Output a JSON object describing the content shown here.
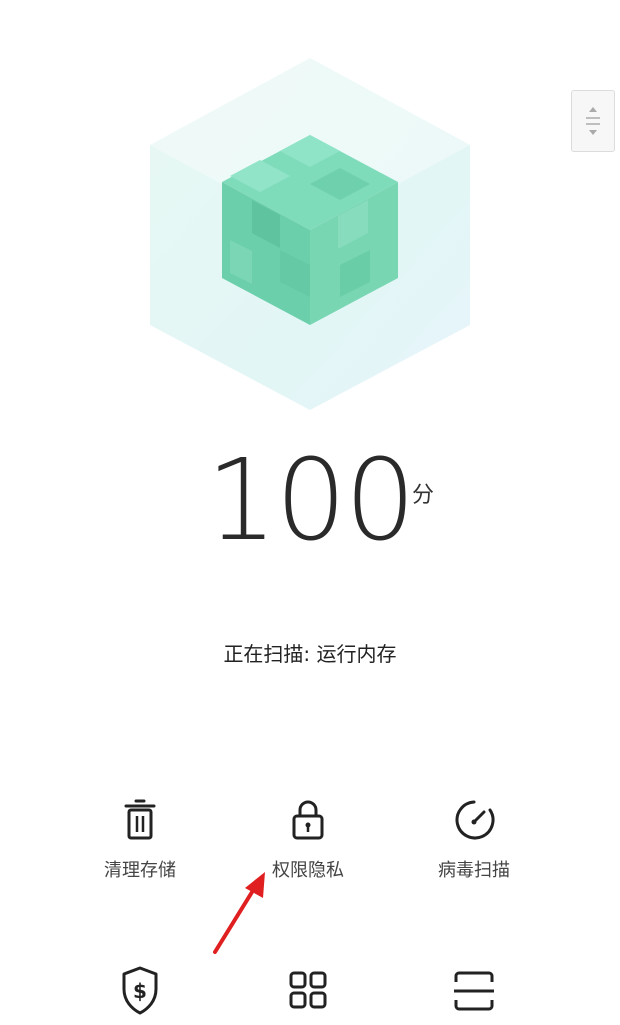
{
  "score": {
    "value": "100",
    "unit": "分"
  },
  "status": {
    "text": "正在扫描: 运行内存"
  },
  "tools": [
    {
      "label": "清理存储",
      "icon": "trash-icon"
    },
    {
      "label": "权限隐私",
      "icon": "lock-icon"
    },
    {
      "label": "病毒扫描",
      "icon": "gauge-icon"
    }
  ],
  "bottom_icons": [
    "shield-dollar-icon",
    "grid-icon",
    "scan-icon"
  ],
  "colors": {
    "cube": "#6fd3ad",
    "hex_glow": "#e3f7f4",
    "arrow": "#e02020"
  }
}
